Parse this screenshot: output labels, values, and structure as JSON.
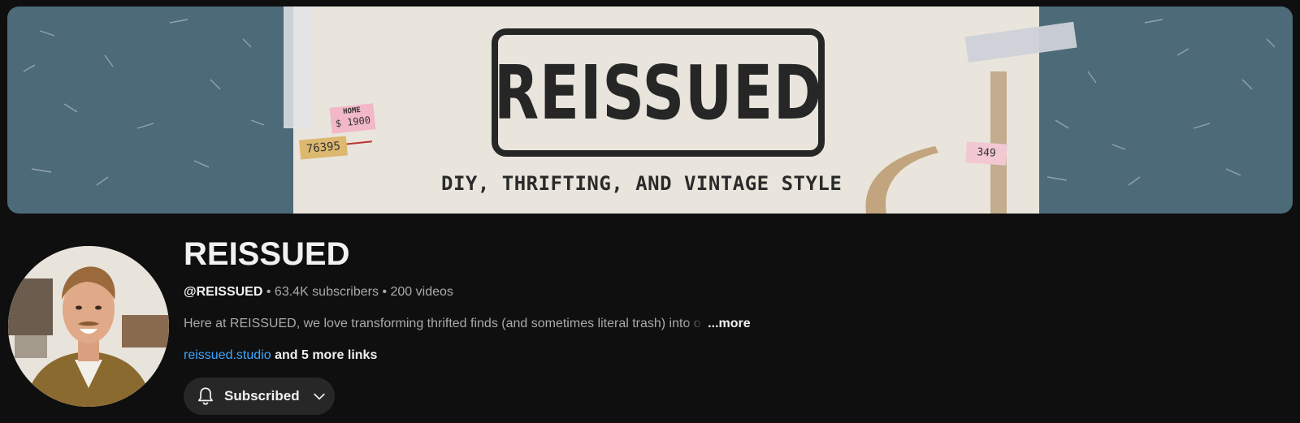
{
  "banner": {
    "logo_text": "REISSUED",
    "tagline": "DIY, THRIFTING, AND VINTAGE STYLE",
    "tag_home_line1": "HOME",
    "tag_home_line2": "$ 1900",
    "tag_number": "76395",
    "tag_price": "349",
    "colors": {
      "background": "#4d6a79",
      "paper": "#e9e5dc",
      "ink": "#262626"
    }
  },
  "channel": {
    "name": "REISSUED",
    "handle": "@REISSUED",
    "subscribers": "63.4K subscribers",
    "videos": "200 videos",
    "separator": "•",
    "description": "Here at REISSUED, we love transforming thrifted finds (and sometimes literal trash) into o",
    "more_label": "...more",
    "link_text": "reissued.studio",
    "more_links_text": "and 5 more links",
    "link_color": "#3ea6ff"
  },
  "subscribe_button": {
    "label": "Subscribed",
    "icons": [
      "bell-icon",
      "chevron-down-icon"
    ]
  },
  "avatar": {
    "icon": "channel-avatar"
  }
}
